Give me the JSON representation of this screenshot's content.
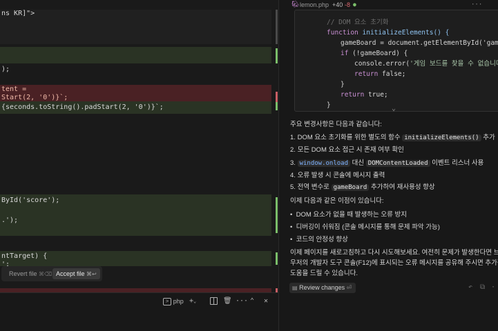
{
  "editor": {
    "lines": [
      {
        "text": "ns KR]\">"
      },
      {
        "text": ");"
      },
      {
        "text": "tent ="
      },
      {
        "text": "Start(2, '0')}`;"
      },
      {
        "text": "{seconds.toString().padStart(2, '0')}`;"
      },
      {
        "text": "ById('score');"
      },
      {
        "text": ".');"
      },
      {
        "text": "ntTarget) {"
      },
      {
        "text": "';"
      },
      {
        "text": "ico"
      }
    ],
    "revert_label": "Revert file",
    "revert_shortcut": "⌘⌫",
    "accept_label": "Accept file",
    "accept_shortcut": "⌘↩"
  },
  "terminal": {
    "shell_label": "php"
  },
  "chat": {
    "file_name": "lemon.php",
    "additions": "+40",
    "deletions": "-8",
    "code_lines": [
      {
        "text": "// DOM 요소 초기화"
      },
      {
        "text": "function initializeElements() {"
      },
      {
        "text": "gameBoard = document.getElementById('gameBoa"
      },
      {
        "text": "if (!gameBoard) {"
      },
      {
        "text": "console.error('게임 보드를 찾을 수 없습니다.'"
      },
      {
        "text": "return false;"
      },
      {
        "text": "}"
      },
      {
        "text": "return true;"
      },
      {
        "text": "}"
      }
    ],
    "intro": "주요 변경사항은 다음과 같습니다:",
    "changes": [
      {
        "num": "1.",
        "before": "DOM 요소 초기화를 위한 별도의 함수 ",
        "code": "initializeElements()",
        "after": " 추가"
      },
      {
        "num": "2.",
        "before": "모든 DOM 요소 접근 시 존재 여부 확인",
        "code": "",
        "after": ""
      },
      {
        "num": "3.",
        "link": "window.onload",
        "before": " 대신 ",
        "code": "DOMContentLoaded",
        "after": " 이벤트 리스너 사용"
      },
      {
        "num": "4.",
        "before": "오류 발생 시 콘솔에 메시지 출력",
        "code": "",
        "after": ""
      },
      {
        "num": "5.",
        "before": "전역 변수로 ",
        "code": "gameBoard",
        "after": " 추가하여 재사용성 향상"
      }
    ],
    "benefits_intro": "이제 다음과 같은 이점이 있습니다:",
    "benefits": [
      "DOM 요소가 없을 때 발생하는 오류 방지",
      "디버깅이 쉬워짐 (콘솔 메시지를 통해 문제 파악 가능)",
      "코드의 안정성 향상"
    ],
    "closing_lines": [
      "이제 페이지를 새로고침하고 다시 시도해보세요. 여전히 문제가 발생한다면 브라",
      "우저의 개발자 도구 콘솔(F12)에 표시되는 오류 메시지를 공유해 주시면 추가적인",
      "도움을 드릴 수 있습니다."
    ],
    "review_label": "Review changes",
    "review_shortcut": "⏎"
  },
  "colors": {
    "added_bg": "#2a3324",
    "removed_bg": "#4a2124",
    "gutter_add": "#7bbf6a",
    "accent": "#cd8bd8"
  }
}
